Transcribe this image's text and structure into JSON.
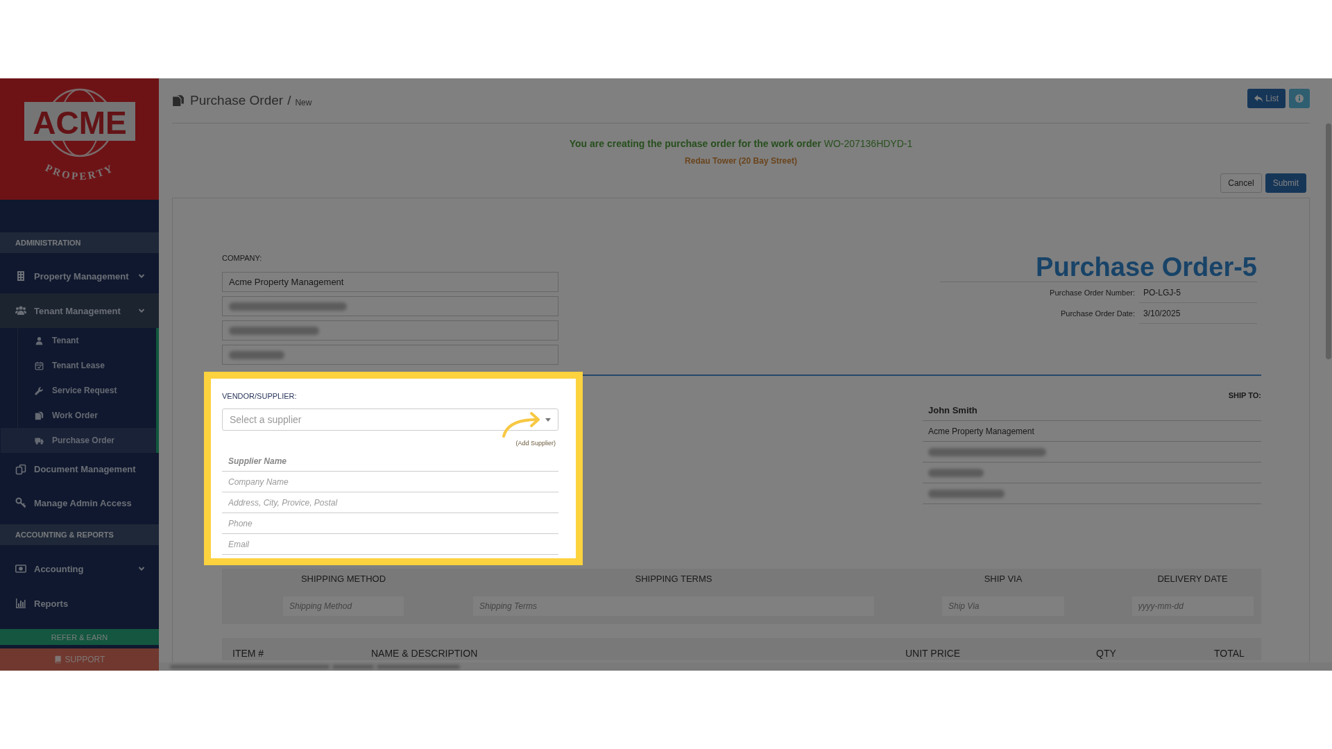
{
  "tutorial_overlay": {
    "dimmed": true
  },
  "sidebar": {
    "logo": {
      "word": "ACME",
      "tagline": "PROPERTY"
    },
    "sections": [
      {
        "title": "ADMINISTRATION",
        "items": [
          {
            "label": "Property Management",
            "expanded": false,
            "active": false
          },
          {
            "label": "Tenant Management",
            "expanded": true,
            "active": true,
            "children": [
              {
                "label": "Tenant",
                "selected": false
              },
              {
                "label": "Tenant Lease",
                "selected": false
              },
              {
                "label": "Service Request",
                "selected": false
              },
              {
                "label": "Work Order",
                "selected": false
              },
              {
                "label": "Purchase Order",
                "selected": true
              }
            ]
          },
          {
            "label": "Document Management",
            "active": false
          },
          {
            "label": "Manage Admin Access",
            "active": false
          }
        ]
      },
      {
        "title": "ACCOUNTING & REPORTS",
        "items": [
          {
            "label": "Accounting",
            "expanded": false,
            "active": false
          },
          {
            "label": "Reports",
            "active": false
          }
        ]
      }
    ],
    "refer_button": "REFER & EARN",
    "support_button": "SUPPORT"
  },
  "header": {
    "title": "Purchase Order",
    "separator": "/",
    "subtitle": "New",
    "buttons": [
      {
        "kind": "list",
        "label": "List"
      },
      {
        "kind": "info"
      }
    ]
  },
  "notice": {
    "statement": "You are creating the purchase order for the work order",
    "work_order": "WO-207136HDYD-1",
    "location": "Redau Tower (20 Bay Street)"
  },
  "actions": [
    {
      "kind": "default",
      "label": "Cancel"
    },
    {
      "kind": "primary",
      "label": "Submit"
    }
  ],
  "company": {
    "label": "COMPANY:",
    "fields": [
      {
        "kind": "text",
        "value": "Acme Property Management"
      },
      {
        "kind": "blurred"
      },
      {
        "kind": "blurred"
      },
      {
        "kind": "blurred"
      }
    ]
  },
  "purchase_order": {
    "title": "Purchase Order-5",
    "details": [
      {
        "label": "Purchase Order Number:",
        "value": "PO-LGJ-5"
      },
      {
        "label": "Purchase Order Date:",
        "value": "3/10/2025"
      }
    ]
  },
  "vendor": {
    "highlighted": true,
    "label": "VENDOR/SUPPLIER:",
    "select": {
      "placeholder": "Select a supplier"
    },
    "add_link": "(Add Supplier)",
    "fields": [
      {
        "kind": "name",
        "placeholder": "Supplier Name"
      },
      {
        "kind": "text",
        "placeholder": "Company Name"
      },
      {
        "kind": "text",
        "placeholder": "Address, City, Provice, Postal"
      },
      {
        "kind": "text",
        "placeholder": "Phone"
      },
      {
        "kind": "text",
        "placeholder": "Email"
      }
    ]
  },
  "ship_to": {
    "label": "SHIP TO:",
    "rows": [
      {
        "kind": "name",
        "text": "John Smith"
      },
      {
        "kind": "text",
        "text": "Acme Property Management"
      },
      {
        "kind": "blurred"
      },
      {
        "kind": "blurred"
      },
      {
        "kind": "blurred"
      }
    ]
  },
  "shipping": {
    "columns": [
      {
        "header": "SHIPPING METHOD",
        "placeholder": "Shipping Method"
      },
      {
        "header": "SHIPPING TERMS",
        "placeholder": "Shipping Terms"
      },
      {
        "header": "SHIP VIA",
        "placeholder": "Ship Via"
      },
      {
        "header": "DELIVERY DATE",
        "placeholder": "yyyy-mm-dd"
      }
    ]
  },
  "items_table": {
    "columns": [
      "ITEM #",
      "NAME & DESCRIPTION",
      "UNIT PRICE",
      "QTY",
      "TOTAL"
    ]
  }
}
